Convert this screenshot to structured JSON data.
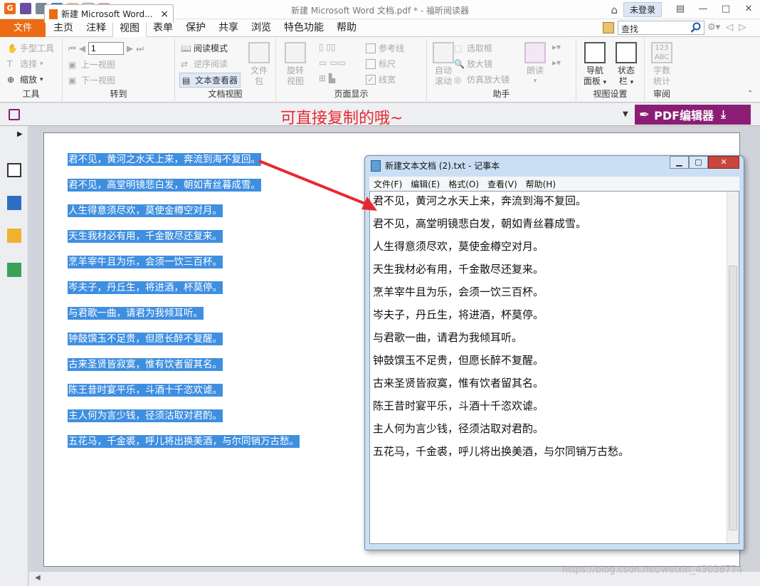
{
  "window": {
    "title": "新建 Microsoft Word 文档.pdf * - 福昕阅读器",
    "login_label": "未登录",
    "controls": [
      "—",
      "□",
      "✕"
    ]
  },
  "menu": {
    "file_label": "文件",
    "tabs": [
      "主页",
      "注释",
      "视图",
      "表单",
      "保护",
      "共享",
      "浏览",
      "特色功能",
      "帮助"
    ],
    "active_tab": "视图",
    "search_value": "查找"
  },
  "ribbon": {
    "tools": {
      "hand": "手型工具",
      "select": "选择",
      "zoom": "缩放",
      "label": "工具"
    },
    "goto": {
      "prev_view": "上一视图",
      "next_view": "下一视图",
      "page_value": "1",
      "label": "转到"
    },
    "docview": {
      "read_mode": "阅读模式",
      "reverse_read": "逆序阅读",
      "text_viewer": "文本查看器",
      "file_pkg_1": "文件",
      "file_pkg_2": "包",
      "label": "文档视图"
    },
    "pagedisp": {
      "rotate_1": "旋转",
      "rotate_2": "视图",
      "guides": "参考线",
      "ruler": "标尺",
      "linewidth": "线宽",
      "label": "页面显示"
    },
    "assist": {
      "auto_1": "自动",
      "auto_2": "滚动",
      "marquee": "选取框",
      "magnifier": "放大镜",
      "loupe": "仿真放大镜",
      "read_aloud": "朗读",
      "label": "助手"
    },
    "viewset": {
      "nav_1": "导航",
      "nav_2": "面板",
      "status_1": "状态",
      "status_2": "栏",
      "label": "视图设置"
    },
    "review": {
      "count_1": "字数",
      "count_2": "统计",
      "label": "审阅"
    }
  },
  "doc_tab": {
    "name": "新建 Microsoft Word...",
    "close": "×"
  },
  "annotation": "可直接复制的哦~",
  "pdf_editor_label": "PDF编辑器",
  "poem_lines": [
    "君不见，黄河之水天上来，奔流到海不复回。",
    "君不见，高堂明镜悲白发，朝如青丝暮成雪。",
    "人生得意须尽欢，莫使金樽空对月。",
    "天生我材必有用，千金散尽还复来。",
    "烹羊宰牛且为乐，会须一饮三百杯。",
    "岑夫子，丹丘生，将进酒，杯莫停。",
    "与君歌一曲，请君为我倾耳听。",
    "钟鼓馔玉不足贵，但愿长醉不复醒。",
    "古来圣贤皆寂寞，惟有饮者留其名。",
    "陈王昔时宴平乐，斗酒十千恣欢谑。",
    "主人何为言少钱，径须沽取对君酌。",
    "五花马，千金裘，呼儿将出换美酒，与尔同销万古愁。"
  ],
  "notepad": {
    "title": "新建文本文档 (2).txt - 记事本",
    "menu": [
      "文件(F)",
      "编辑(E)",
      "格式(O)",
      "查看(V)",
      "帮助(H)"
    ],
    "lines": [
      "君不见，黄河之水天上来，奔流到海不复回。",
      "君不见，高堂明镜悲白发，朝如青丝暮成雪。",
      "人生得意须尽欢，莫使金樽空对月。",
      "天生我材必有用，千金散尽还复来。",
      "烹羊宰牛且为乐，会须一饮三百杯。",
      "岑夫子，丹丘生，将进酒，杯莫停。",
      "与君歌一曲，请君为我倾耳听。",
      "钟鼓馔玉不足贵，但愿长醉不复醒。",
      "古来圣贤皆寂寞，惟有饮者留其名。",
      "陈王昔时宴平乐，斗酒十千恣欢谑。",
      "主人何为言少钱，径须沽取对君酌。",
      "五花马，千金裘，呼儿将出换美酒，与尔同销万古愁。"
    ]
  },
  "watermark": "https://blog.csdn.net/weixin_43036774",
  "colors": {
    "accent": "#ec6b14",
    "selection": "#3f8fe0",
    "annotation": "#e8282f",
    "pdf_editor": "#8b1e74"
  }
}
